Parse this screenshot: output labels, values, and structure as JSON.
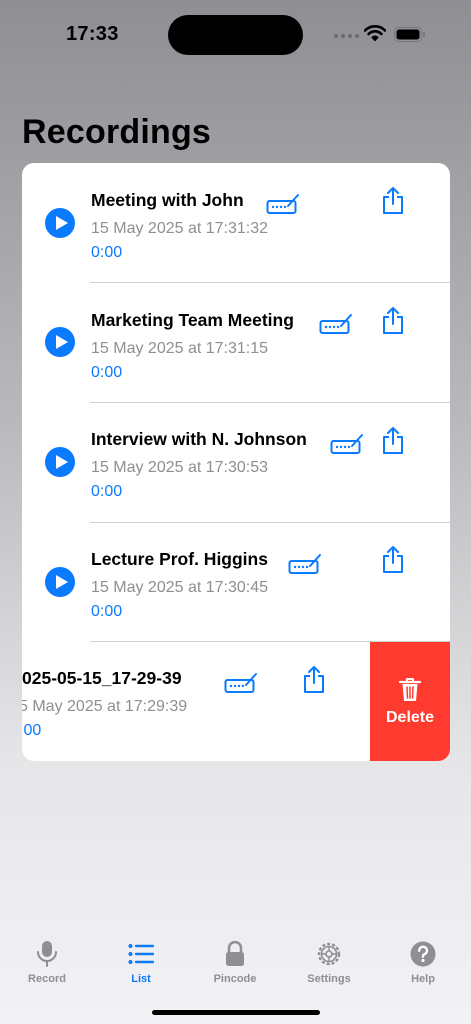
{
  "status_bar": {
    "time": "17:33"
  },
  "page_title": "Recordings",
  "accent_color": "#0a7aff",
  "delete_color": "#ff3b30",
  "recordings": [
    {
      "title": "Meeting with John",
      "date": "15 May 2025 at 17:31:32",
      "duration": "0:00"
    },
    {
      "title": "Marketing Team Meeting",
      "date": "15 May 2025 at 17:31:15",
      "duration": "0:00"
    },
    {
      "title": "Interview with N. Johnson",
      "date": "15 May 2025 at 17:30:53",
      "duration": "0:00"
    },
    {
      "title": "Lecture Prof. Higgins",
      "date": "15 May 2025 at 17:30:45",
      "duration": "0:00"
    },
    {
      "title": "025-05-15_17-29-39",
      "date": "5 May 2025 at 17:29:39",
      "duration": ":00"
    }
  ],
  "swipe_actions": {
    "delete_label": "Delete"
  },
  "icons": {
    "play": "play-icon",
    "transcribe": "keyboard-pencil-icon",
    "share": "share-icon",
    "delete": "trash-icon"
  },
  "tab_bar": {
    "tabs": [
      {
        "label": "Record",
        "icon": "microphone-icon"
      },
      {
        "label": "List",
        "icon": "list-icon"
      },
      {
        "label": "Pincode",
        "icon": "lock-icon"
      },
      {
        "label": "Settings",
        "icon": "gear-icon"
      },
      {
        "label": "Help",
        "icon": "question-icon"
      }
    ],
    "active_tab": "List"
  }
}
